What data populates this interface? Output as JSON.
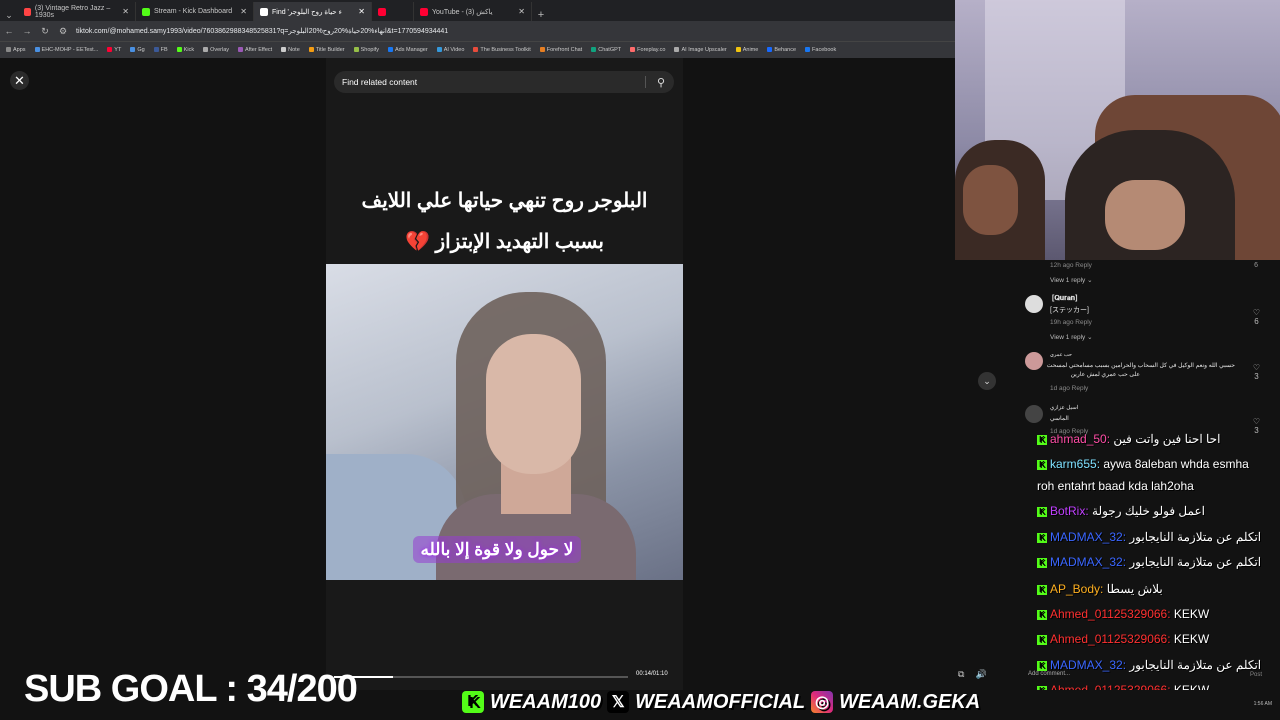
{
  "browser": {
    "tabs": [
      {
        "title": "(3) Vintage Retro Jazz – 1930s",
        "color": "#ff4444"
      },
      {
        "title": "Stream - Kick Dashboard",
        "color": "#53fc18"
      },
      {
        "title": "Find 'انهاء حياة روح البلوجر' | TikTok",
        "color": "#ffffff"
      },
      {
        "title": "",
        "color": "#ff0033"
      },
      {
        "title": "YouTube - (3) ياكش",
        "color": "#ff0033"
      }
    ],
    "url": "tiktok.com/@mohamed.samy1993/video/7603862988348525831?q=انهاء%20حياة%20روح%20البلوجر&t=1770594934441",
    "bookmarks": [
      "Apps",
      "EHC-MOHP - EETest...",
      "YT",
      "Gg",
      "FB",
      "Kick",
      "Overlay",
      "After Effect",
      "Note",
      "Title Builder",
      "Shopify",
      "Ads Manager",
      "AI Video",
      "The Business Toolkit",
      "Forefront Chat",
      "ChatGPT",
      "Foreplay.co",
      "AI Image Upscaler",
      "Anime",
      "Behance",
      "Facebook"
    ]
  },
  "video": {
    "search_placeholder": "Find related content",
    "caption_line1": "البلوجر روح تنهي حياتها علي اللايف",
    "caption_line2": "بسبب التهديد الإبتزاز 💔",
    "subtitle": "لا حول ولا قوة إلا بالله",
    "time": "00:14/01:10",
    "progress_fraction": 0.2
  },
  "overlay": {
    "sub_goal": "SUB GOAL : 34/200",
    "kick_handle": "WEAAM100",
    "x_handle": "WEAAMOFFICIAL",
    "ig_handle": "WEAAM.GEKA"
  },
  "comments": [
    {
      "meta": "12h ago   Reply",
      "count": "6"
    },
    {
      "meta": "View 1 reply ⌄"
    },
    {
      "name": "[𝐐𝐮𝐫𝐚𝐧]",
      "text": "[ステッカー]",
      "meta": "19h ago   Reply",
      "count": "6"
    },
    {
      "meta": "View 1 reply ⌄"
    },
    {
      "name": "حب عمري",
      "text": "حسبي الله ونعم الوكيل في كل السحاب والحرامين بسبب مسامحتي لمسحت",
      "text2": "على حب عمري لمش عارين",
      "meta": "1d ago   Reply",
      "count": "3"
    },
    {
      "name": "اسيل عزازي",
      "text": "الماسي",
      "meta": "1d ago   Reply",
      "count": "3"
    }
  ],
  "chat": [
    {
      "user": "ahmad_50",
      "color": "#ff4da6",
      "text": "احا احنا فين واتت فين"
    },
    {
      "user": "karm655",
      "color": "#7ee0ff",
      "text": "aywa 8aleban whda esmha"
    },
    {
      "user": "",
      "color": "#ffffff",
      "text": "roh entahrt baad kda lah2oha"
    },
    {
      "user": "BotRix",
      "color": "#c040ff",
      "text": "اعمل فولو خليك رجولة"
    },
    {
      "user": "MADMAX_32",
      "color": "#3a66ff",
      "text": "اتكلم عن متلازمة النايجابور"
    },
    {
      "user": "MADMAX_32",
      "color": "#3a66ff",
      "text": "اتكلم عن متلازمة النايجابور"
    },
    {
      "user": "AP_Body",
      "color": "#ffb020",
      "text": "بلاش يسطا"
    },
    {
      "user": "Ahmed_01125329066",
      "color": "#ff3030",
      "text": "KEKW"
    },
    {
      "user": "Ahmed_01125329066",
      "color": "#ff3030",
      "text": "KEKW"
    },
    {
      "user": "MADMAX_32",
      "color": "#3a66ff",
      "text": "اتكلم عن متلازمة النايجابور"
    },
    {
      "user": "Ahmed_01125329066",
      "color": "#ff3030",
      "text": "KEKW"
    }
  ],
  "comment_input_placeholder": "Add comment...",
  "post_label": "Post",
  "clock": "1:56 AM"
}
